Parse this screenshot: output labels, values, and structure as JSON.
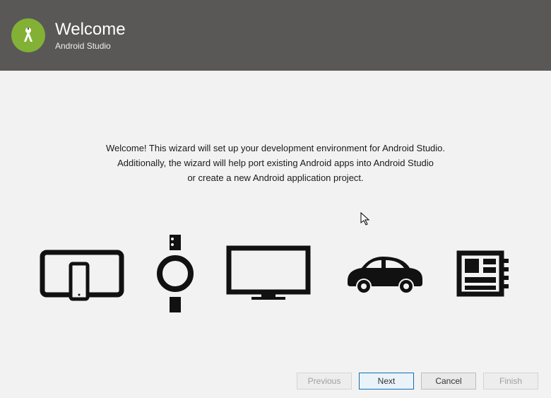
{
  "header": {
    "title": "Welcome",
    "subtitle": "Android Studio"
  },
  "body": {
    "line1": "Welcome! This wizard will set up your development environment for Android Studio.",
    "line2": "Additionally, the wizard will help port existing Android apps into Android Studio",
    "line3": "or create a new Android application project."
  },
  "icons": {
    "tablet_phone": "tablet-phone",
    "watch": "watch",
    "tv": "tv",
    "car": "car",
    "things": "things"
  },
  "buttons": {
    "previous": "Previous",
    "next": "Next",
    "cancel": "Cancel",
    "finish": "Finish"
  }
}
